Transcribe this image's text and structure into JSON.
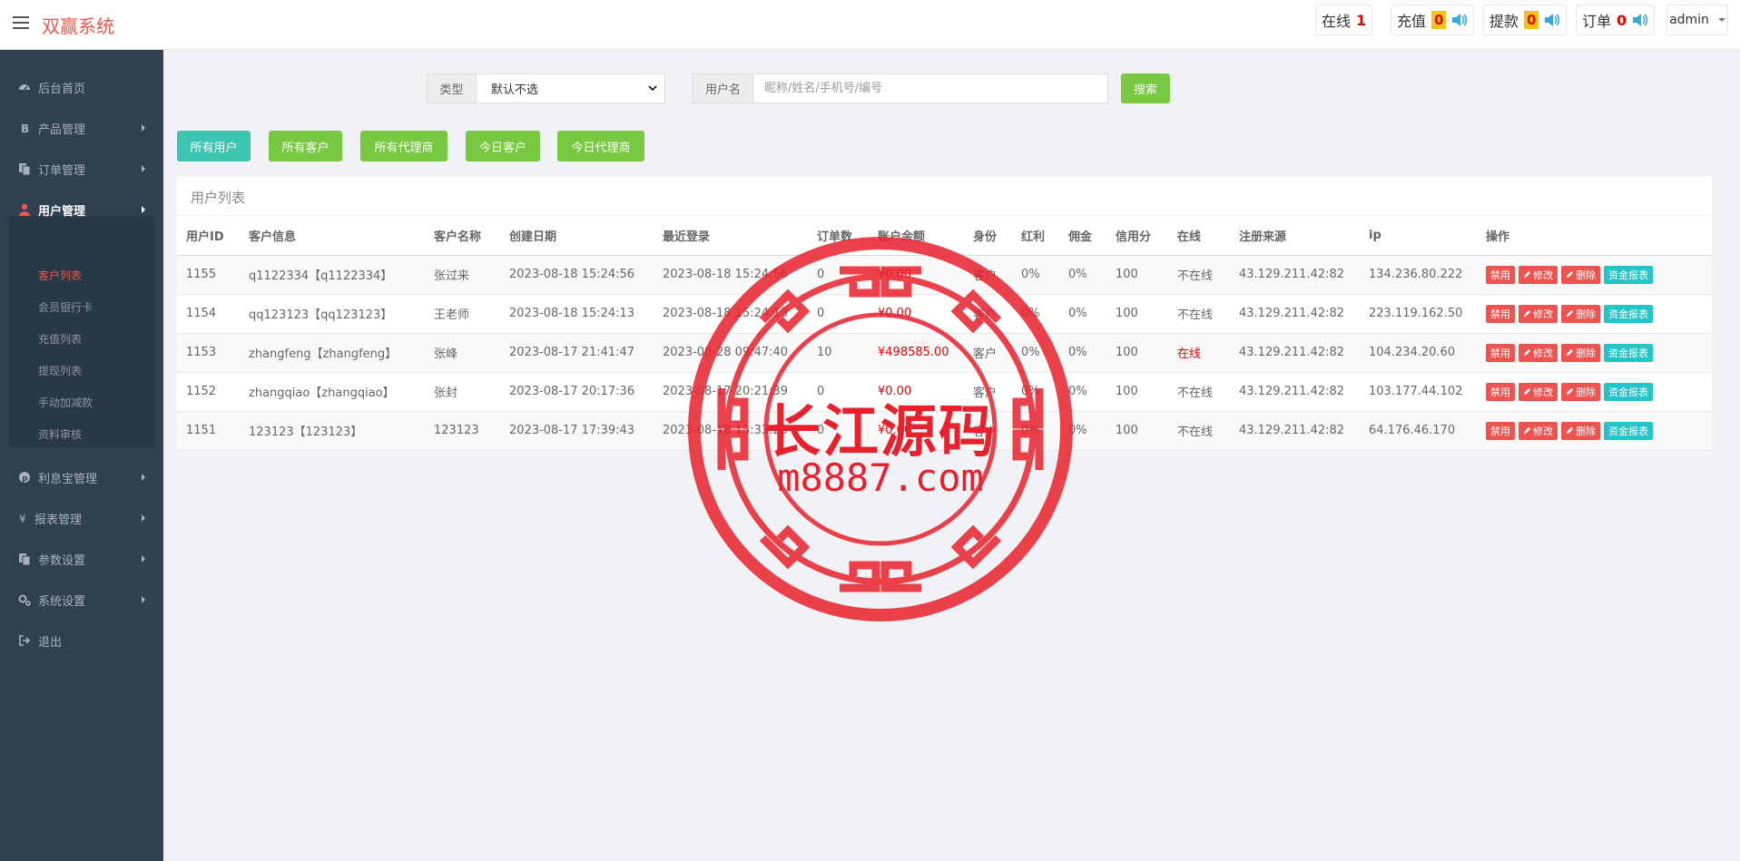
{
  "app": {
    "title": "双赢系统"
  },
  "header": {
    "online_label": "在线",
    "online_count": "1",
    "recharge_label": "充值",
    "recharge_count": "0",
    "withdraw_label": "提款",
    "withdraw_count": "0",
    "order_label": "订单",
    "order_count": "0",
    "user": "admin"
  },
  "sidebar": {
    "items": [
      {
        "label": "后台首页",
        "icon": "dashboard-icon"
      },
      {
        "label": "产品管理",
        "icon": "bitcoin-icon"
      },
      {
        "label": "订单管理",
        "icon": "copy-icon"
      },
      {
        "label": "用户管理",
        "icon": "user-icon"
      },
      {
        "label": "利息宝管理",
        "icon": "pinterest-icon"
      },
      {
        "label": "报表管理",
        "icon": "yen-icon"
      },
      {
        "label": "参数设置",
        "icon": "copy-icon"
      },
      {
        "label": "系统设置",
        "icon": "gears-icon"
      },
      {
        "label": "退出",
        "icon": "sign-out-icon"
      }
    ],
    "subitems": [
      "客户列表",
      "会员银行卡",
      "充值列表",
      "提现列表",
      "手动加减款",
      "资料审核"
    ]
  },
  "filters": {
    "type_label": "类型",
    "type_value": "默认不选",
    "user_label": "用户名",
    "user_placeholder": "昵称/姓名/手机号/编号",
    "search_button": "搜索"
  },
  "tabs": [
    "所有用户",
    "所有客户",
    "所有代理商",
    "今日客户",
    "今日代理商"
  ],
  "panel": {
    "title": "用户列表"
  },
  "table": {
    "headers": [
      "用户ID",
      "客户信息",
      "客户名称",
      "创建日期",
      "最近登录",
      "订单数",
      "账户余额",
      "身份",
      "红利",
      "佣金",
      "信用分",
      "在线",
      "注册来源",
      "ip",
      "操作"
    ],
    "rows": [
      [
        "1155",
        "q1122334【q1122334】",
        "张过来",
        "2023-08-18 15:24:56",
        "2023-08-18 15:24:56",
        "0",
        "¥0.00",
        "客户",
        "0%",
        "0%",
        "100",
        "不在线",
        "43.129.211.42:82",
        "134.236.80.222"
      ],
      [
        "1154",
        "qq123123【qq123123】",
        "王老师",
        "2023-08-18 15:24:13",
        "2023-08-18 15:24:13",
        "0",
        "¥0.00",
        "客户",
        "0%",
        "0%",
        "100",
        "不在线",
        "43.129.211.42:82",
        "223.119.162.50"
      ],
      [
        "1153",
        "zhangfeng【zhangfeng】",
        "张峰",
        "2023-08-17 21:41:47",
        "2023-08-28 09:47:40",
        "10",
        "¥498585.00",
        "客户",
        "0%",
        "0%",
        "100",
        "在线",
        "43.129.211.42:82",
        "104.234.20.60"
      ],
      [
        "1152",
        "zhangqiao【zhangqiao】",
        "张封",
        "2023-08-17 20:17:36",
        "2023-08-17 20:21:39",
        "0",
        "¥0.00",
        "客户",
        "0%",
        "0%",
        "100",
        "不在线",
        "43.129.211.42:82",
        "103.177.44.102"
      ],
      [
        "1151",
        "123123【123123】",
        "123123",
        "2023-08-17 17:39:43",
        "2023-08-18 15:33:20",
        "0",
        "¥0.00",
        "客户",
        "0%",
        "0%",
        "100",
        "不在线",
        "43.129.211.42:82",
        "64.176.46.170"
      ]
    ],
    "actions": [
      "禁用",
      "修改",
      "删除",
      "资金报表"
    ]
  },
  "watermark": {
    "line1": "长江源码",
    "line2": "m8887.com"
  },
  "colors": {
    "brand": "#e8584f",
    "sidebar": "#2f4050",
    "green": "#78c842",
    "teal": "#3cc6b2",
    "danger": "#ef5350"
  }
}
